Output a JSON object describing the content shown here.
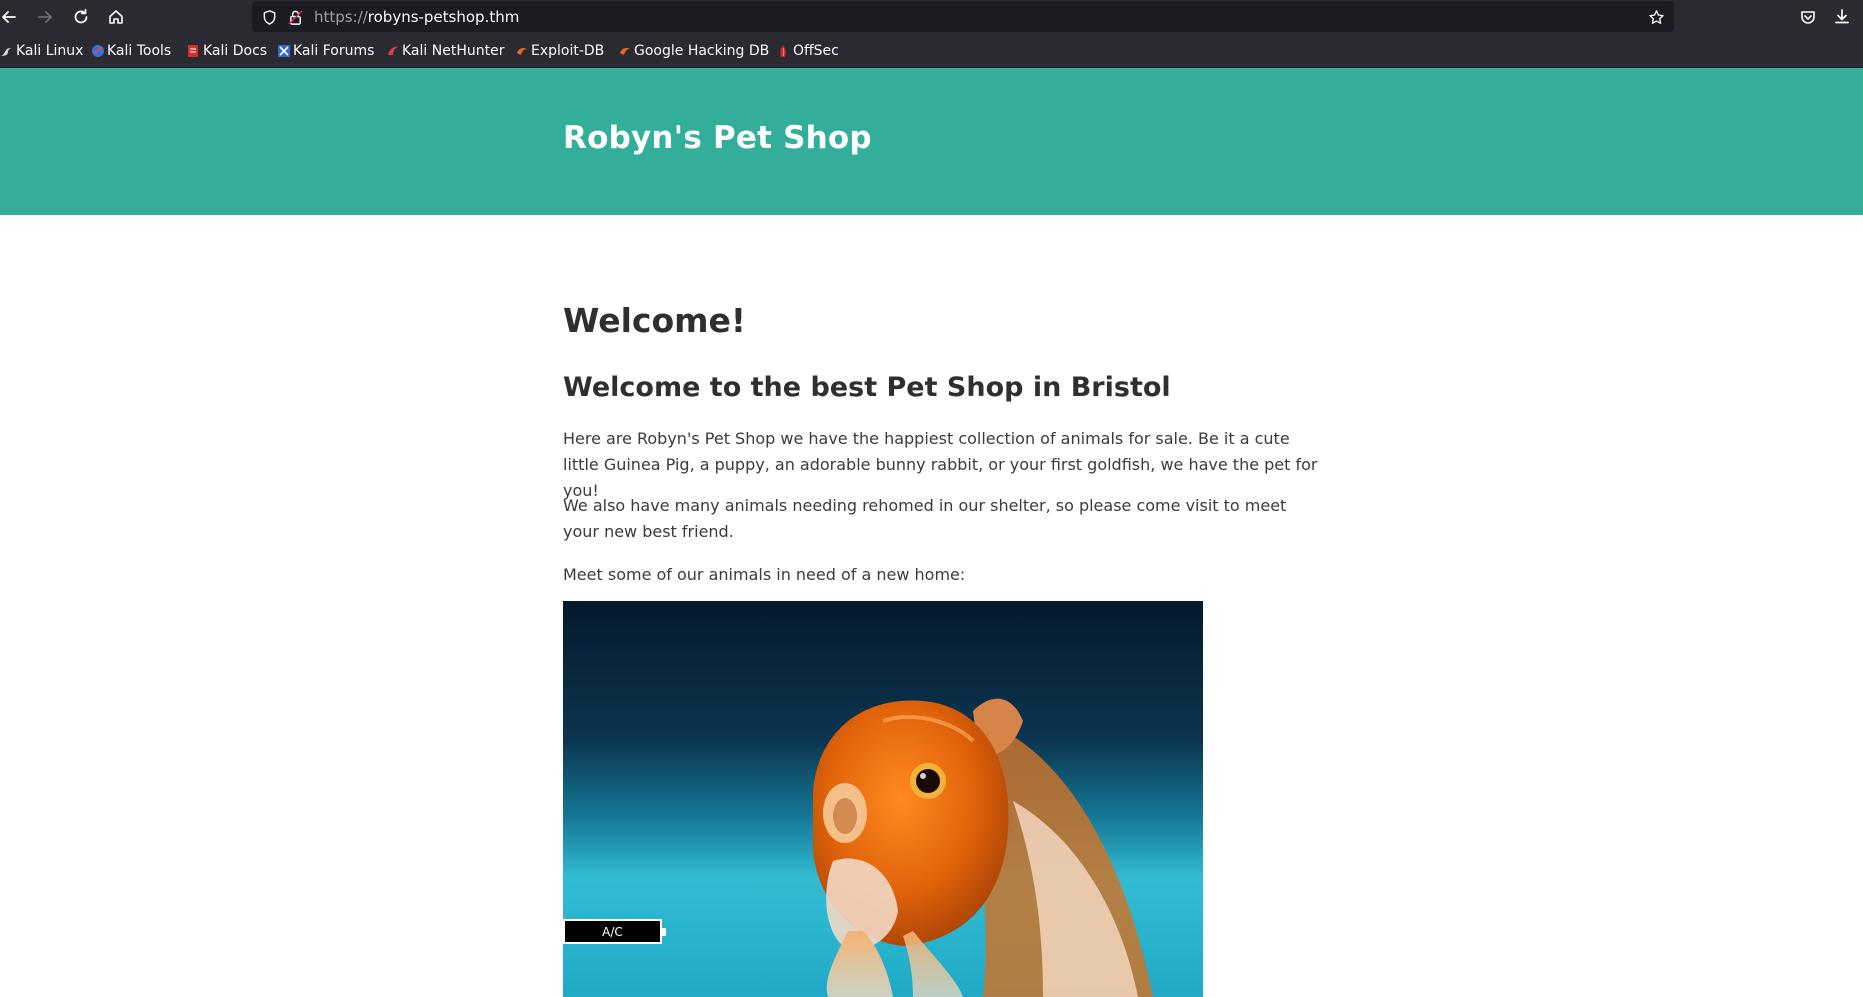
{
  "browser": {
    "url_scheme": "https://",
    "url_host": "robyns-petshop.thm",
    "icons": [
      "back-arrow-icon",
      "forward-arrow-icon",
      "reload-icon",
      "home-icon",
      "shield-icon",
      "lock-icon",
      "star-icon",
      "pocket-icon",
      "download-icon"
    ],
    "bookmarks": [
      {
        "label": "Kali Linux",
        "icon": "kali-dragon-icon"
      },
      {
        "label": "Kali Tools",
        "icon": "kali-tools-icon"
      },
      {
        "label": "Kali Docs",
        "icon": "kali-docs-icon"
      },
      {
        "label": "Kali Forums",
        "icon": "kali-forums-icon"
      },
      {
        "label": "Kali NetHunter",
        "icon": "nethunter-icon"
      },
      {
        "label": "Exploit-DB",
        "icon": "exploit-db-icon"
      },
      {
        "label": "Google Hacking DB",
        "icon": "ghdb-icon"
      },
      {
        "label": "OffSec",
        "icon": "offsec-icon"
      }
    ]
  },
  "site": {
    "title": "Robyn's Pet Shop",
    "header_color": "#32ae9b"
  },
  "main": {
    "heading": "Welcome!",
    "subheading": "Welcome to the best Pet Shop in Bristol",
    "paragraphs": [
      "Here are Robyn's Pet Shop we have the happiest collection of animals for sale. Be it a cute little Guinea Pig, a puppy, an adorable bunny rabbit, or your first goldfish, we have the pet for you!",
      "We also have many animals needing rehomed in our shelter, so please come visit to meet your new best friend.",
      "Meet some of our animals in need of a new home:"
    ],
    "image_subject": "goldfish-photo"
  },
  "overlay": {
    "battery_label": "A/C"
  }
}
